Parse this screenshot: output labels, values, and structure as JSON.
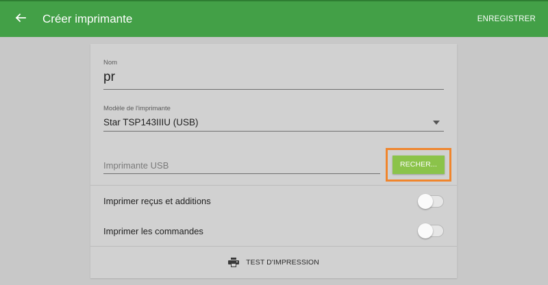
{
  "appbar": {
    "back_icon": "arrow-left-icon",
    "title": "Créer imprimante",
    "save_label": "ENREGISTRER",
    "color": "#43a047"
  },
  "form": {
    "name": {
      "label": "Nom",
      "value": "pr"
    },
    "model": {
      "label": "Modèle de l'imprimante",
      "value": "Star TSP143IIIU (USB)",
      "dropdown_icon": "dropdown-arrow-icon"
    },
    "usb_printer": {
      "placeholder": "Imprimante USB",
      "search_label": "RECHER...",
      "search_color": "#8bc34a",
      "highlight_color": "#f0852c"
    },
    "toggles": [
      {
        "label": "Imprimer reçus et additions",
        "enabled": false
      },
      {
        "label": "Imprimer les commandes",
        "enabled": false
      }
    ],
    "test_print": {
      "icon": "printer-icon",
      "label": "TEST D'IMPRESSION"
    }
  }
}
